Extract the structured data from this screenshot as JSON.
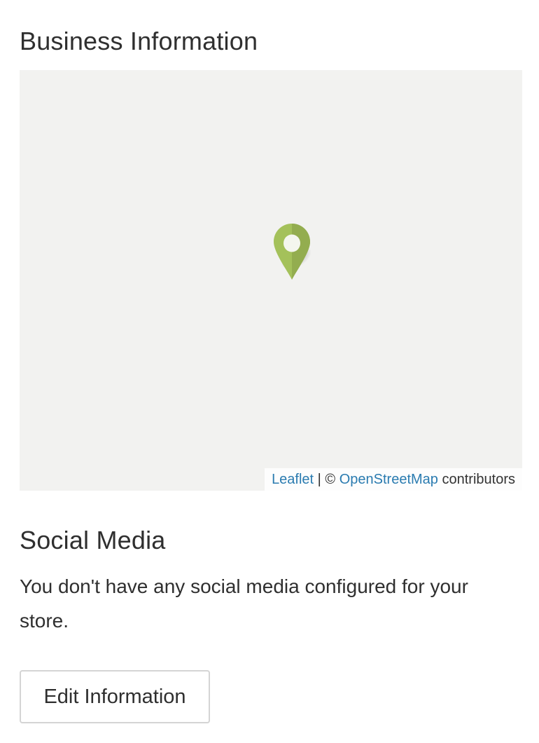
{
  "business": {
    "title": "Business Information"
  },
  "map": {
    "background_color": "#f2f2f0",
    "marker_color": "#a4c15a",
    "marker_icon": "map-pin-icon",
    "attribution": {
      "leaflet_link": "Leaflet",
      "separator": " | © ",
      "osm_link": "OpenStreetMap",
      "suffix": " contributors"
    }
  },
  "social": {
    "title": "Social Media",
    "message": "You don't have any social media configured for your store."
  },
  "actions": {
    "edit_label": "Edit Information"
  }
}
